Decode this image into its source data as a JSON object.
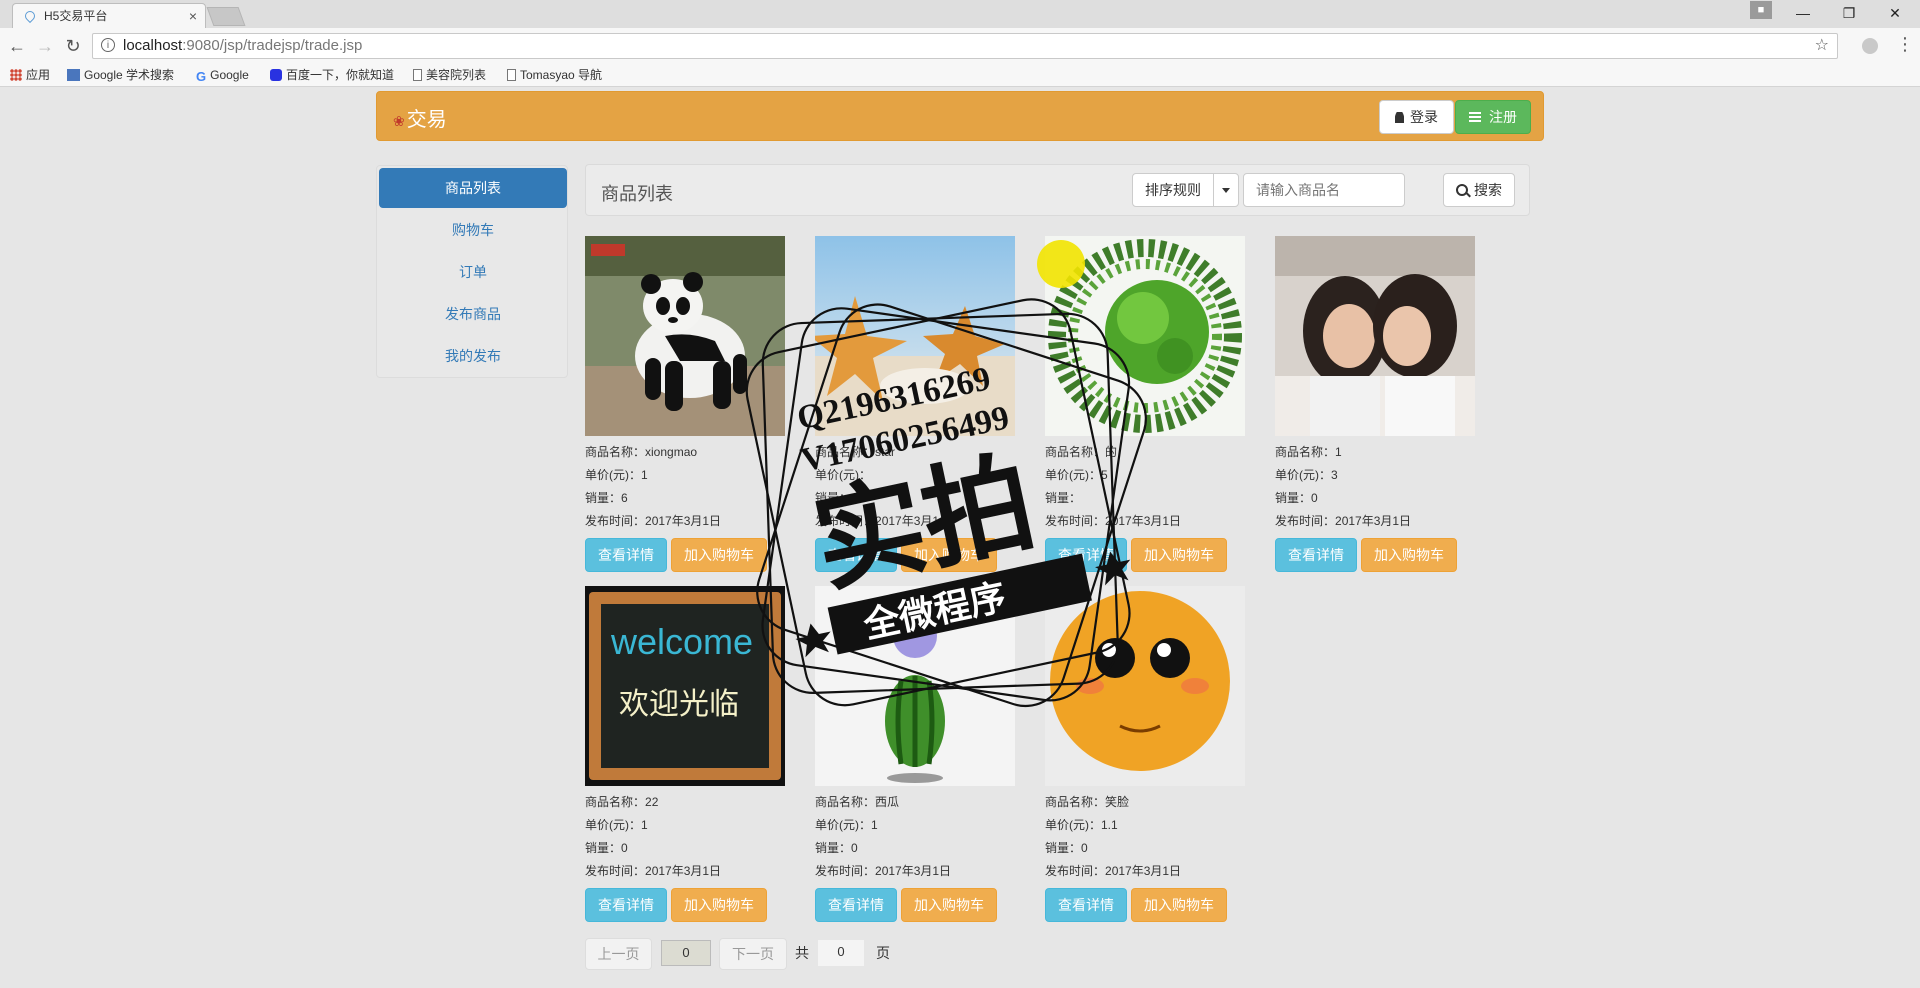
{
  "browser": {
    "tab_title": "H5交易平台",
    "tab_close": "×",
    "url_host": "localhost",
    "url_rest": ":9080/jsp/tradejsp/trade.jsp",
    "window_controls": {
      "minimize": "—",
      "restore": "❐",
      "close": "✕"
    },
    "bookmarks": [
      {
        "label": "应用",
        "icon": "apps-icon"
      },
      {
        "label": "Google 学术搜索",
        "icon": "scholar-icon"
      },
      {
        "label": "Google",
        "icon": "google-icon"
      },
      {
        "label": "百度一下，你就知道",
        "icon": "baidu-icon"
      },
      {
        "label": "美容院列表",
        "icon": "page-icon"
      },
      {
        "label": "Tomasyao 导航",
        "icon": "page-icon"
      }
    ]
  },
  "navbar": {
    "brand": "交易",
    "login_label": "登录",
    "register_label": "注册",
    "brand_color": "#e4a344"
  },
  "sidebar": {
    "items": [
      {
        "label": "商品列表",
        "active": true
      },
      {
        "label": "购物车"
      },
      {
        "label": "订单"
      },
      {
        "label": "发布商品"
      },
      {
        "label": "我的发布"
      }
    ]
  },
  "panel": {
    "title": "商品列表",
    "sort_label": "排序规则",
    "search_placeholder": "请输入商品名",
    "search_label": "搜索"
  },
  "labels": {
    "name": "商品名称：",
    "price": "单价(元)：",
    "sales": "销量：",
    "date": "发布时间：",
    "detail_btn": "查看详情",
    "cart_btn": "加入购物车"
  },
  "products": [
    {
      "name": "xiongmao",
      "price": "1",
      "sales": "6",
      "date": "2017年3月1日",
      "image": "panda"
    },
    {
      "name": "star",
      "price": "",
      "sales": "",
      "date": "2017年3月1日",
      "image": "starfish"
    },
    {
      "name": "的",
      "price": "5",
      "sales": "",
      "date": "2017年3月1日",
      "image": "green-planet"
    },
    {
      "name": "1",
      "price": "3",
      "sales": "0",
      "date": "2017年3月1日",
      "image": "girls"
    },
    {
      "name": "22",
      "price": "1",
      "sales": "0",
      "date": "2017年3月1日",
      "image": "welcome-board"
    },
    {
      "name": "西瓜",
      "price": "1",
      "sales": "0",
      "date": "2017年3月1日",
      "image": "watermelon"
    },
    {
      "name": "笑脸",
      "price": "1.1",
      "sales": "0",
      "date": "2017年3月1日",
      "image": "smiley"
    }
  ],
  "pagination": {
    "prev": "上一页",
    "current": "0",
    "next": "下一页",
    "total_prefix": "共",
    "total": "0",
    "total_suffix": "页"
  },
  "watermark": {
    "line1": "Q2196316269",
    "line2": "V17060256499",
    "main": "实拍",
    "ribbon": "全微程序"
  },
  "image_texts": {
    "welcome": "welcome",
    "welcome_cn": "欢迎光临"
  }
}
